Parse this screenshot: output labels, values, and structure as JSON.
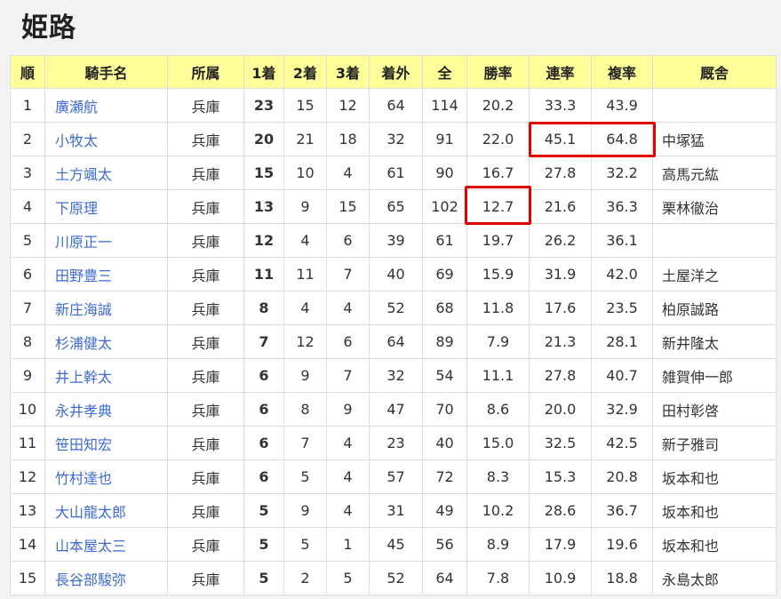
{
  "title": "姫路",
  "headers": [
    "順",
    "騎手名",
    "所属",
    "1着",
    "2着",
    "3着",
    "着外",
    "全",
    "勝率",
    "連率",
    "複率",
    "厩舎"
  ],
  "rows": [
    {
      "rank": "1",
      "name": "廣瀬航",
      "affil": "兵庫",
      "w1": "23",
      "w2": "15",
      "w3": "12",
      "out": "64",
      "total": "114",
      "win": "20.2",
      "ren": "33.3",
      "fuku": "43.9",
      "stable": ""
    },
    {
      "rank": "2",
      "name": "小牧太",
      "affil": "兵庫",
      "w1": "20",
      "w2": "21",
      "w3": "18",
      "out": "32",
      "total": "91",
      "win": "22.0",
      "ren": "45.1",
      "fuku": "64.8",
      "stable": "中塚猛"
    },
    {
      "rank": "3",
      "name": "土方颯太",
      "affil": "兵庫",
      "w1": "15",
      "w2": "10",
      "w3": "4",
      "out": "61",
      "total": "90",
      "win": "16.7",
      "ren": "27.8",
      "fuku": "32.2",
      "stable": "高馬元紘"
    },
    {
      "rank": "4",
      "name": "下原理",
      "affil": "兵庫",
      "w1": "13",
      "w2": "9",
      "w3": "15",
      "out": "65",
      "total": "102",
      "win": "12.7",
      "ren": "21.6",
      "fuku": "36.3",
      "stable": "栗林徹治"
    },
    {
      "rank": "5",
      "name": "川原正一",
      "affil": "兵庫",
      "w1": "12",
      "w2": "4",
      "w3": "6",
      "out": "39",
      "total": "61",
      "win": "19.7",
      "ren": "26.2",
      "fuku": "36.1",
      "stable": ""
    },
    {
      "rank": "6",
      "name": "田野豊三",
      "affil": "兵庫",
      "w1": "11",
      "w2": "11",
      "w3": "7",
      "out": "40",
      "total": "69",
      "win": "15.9",
      "ren": "31.9",
      "fuku": "42.0",
      "stable": "土屋洋之"
    },
    {
      "rank": "7",
      "name": "新庄海誠",
      "affil": "兵庫",
      "w1": "8",
      "w2": "4",
      "w3": "4",
      "out": "52",
      "total": "68",
      "win": "11.8",
      "ren": "17.6",
      "fuku": "23.5",
      "stable": "柏原誠路"
    },
    {
      "rank": "8",
      "name": "杉浦健太",
      "affil": "兵庫",
      "w1": "7",
      "w2": "12",
      "w3": "6",
      "out": "64",
      "total": "89",
      "win": "7.9",
      "ren": "21.3",
      "fuku": "28.1",
      "stable": "新井隆太"
    },
    {
      "rank": "9",
      "name": "井上幹太",
      "affil": "兵庫",
      "w1": "6",
      "w2": "9",
      "w3": "7",
      "out": "32",
      "total": "54",
      "win": "11.1",
      "ren": "27.8",
      "fuku": "40.7",
      "stable": "雑賀伸一郎"
    },
    {
      "rank": "10",
      "name": "永井孝典",
      "affil": "兵庫",
      "w1": "6",
      "w2": "8",
      "w3": "9",
      "out": "47",
      "total": "70",
      "win": "8.6",
      "ren": "20.0",
      "fuku": "32.9",
      "stable": "田村彰啓"
    },
    {
      "rank": "11",
      "name": "笹田知宏",
      "affil": "兵庫",
      "w1": "6",
      "w2": "7",
      "w3": "4",
      "out": "23",
      "total": "40",
      "win": "15.0",
      "ren": "32.5",
      "fuku": "42.5",
      "stable": "新子雅司"
    },
    {
      "rank": "12",
      "name": "竹村達也",
      "affil": "兵庫",
      "w1": "6",
      "w2": "5",
      "w3": "4",
      "out": "57",
      "total": "72",
      "win": "8.3",
      "ren": "15.3",
      "fuku": "20.8",
      "stable": "坂本和也"
    },
    {
      "rank": "13",
      "name": "大山龍太郎",
      "affil": "兵庫",
      "w1": "5",
      "w2": "9",
      "w3": "4",
      "out": "31",
      "total": "49",
      "win": "10.2",
      "ren": "28.6",
      "fuku": "36.7",
      "stable": "坂本和也"
    },
    {
      "rank": "14",
      "name": "山本屋太三",
      "affil": "兵庫",
      "w1": "5",
      "w2": "5",
      "w3": "1",
      "out": "45",
      "total": "56",
      "win": "8.9",
      "ren": "17.9",
      "fuku": "19.6",
      "stable": "坂本和也"
    },
    {
      "rank": "15",
      "name": "長谷部駿弥",
      "affil": "兵庫",
      "w1": "5",
      "w2": "2",
      "w3": "5",
      "out": "52",
      "total": "64",
      "win": "7.8",
      "ren": "10.9",
      "fuku": "18.8",
      "stable": "永島太郎"
    }
  ],
  "highlight_color": "#e00000",
  "link_color": "#3d6bd1",
  "header_bg": "#ffff99"
}
